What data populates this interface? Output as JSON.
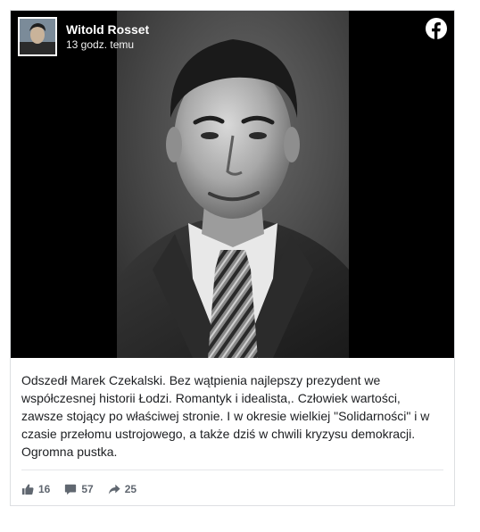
{
  "post": {
    "author": "Witold Rosset",
    "time": "13 godz. temu",
    "text": "Odszedł Marek Czekalski. Bez wątpienia najlepszy prezydent we współczesnej historii Łodzi. Romantyk i idealista,. Człowiek wartości, zawsze stojący po właściwej stronie. I w okresie wielkiej \"Solidarności\" i w czasie przełomu ustrojowego, a także dziś w chwili kryzysu demokracji. Ogromna pustka.",
    "stats": {
      "likes": "16",
      "comments": "57",
      "shares": "25"
    }
  },
  "icons": {
    "brand": "facebook-icon",
    "like": "thumbs-up-icon",
    "comment": "comment-bubble-icon",
    "share": "share-arrow-icon"
  },
  "colors": {
    "facebook_logo": "#ffffff",
    "stat_text": "#606770",
    "body_text": "#1c1e21",
    "media_background": "#000000"
  }
}
